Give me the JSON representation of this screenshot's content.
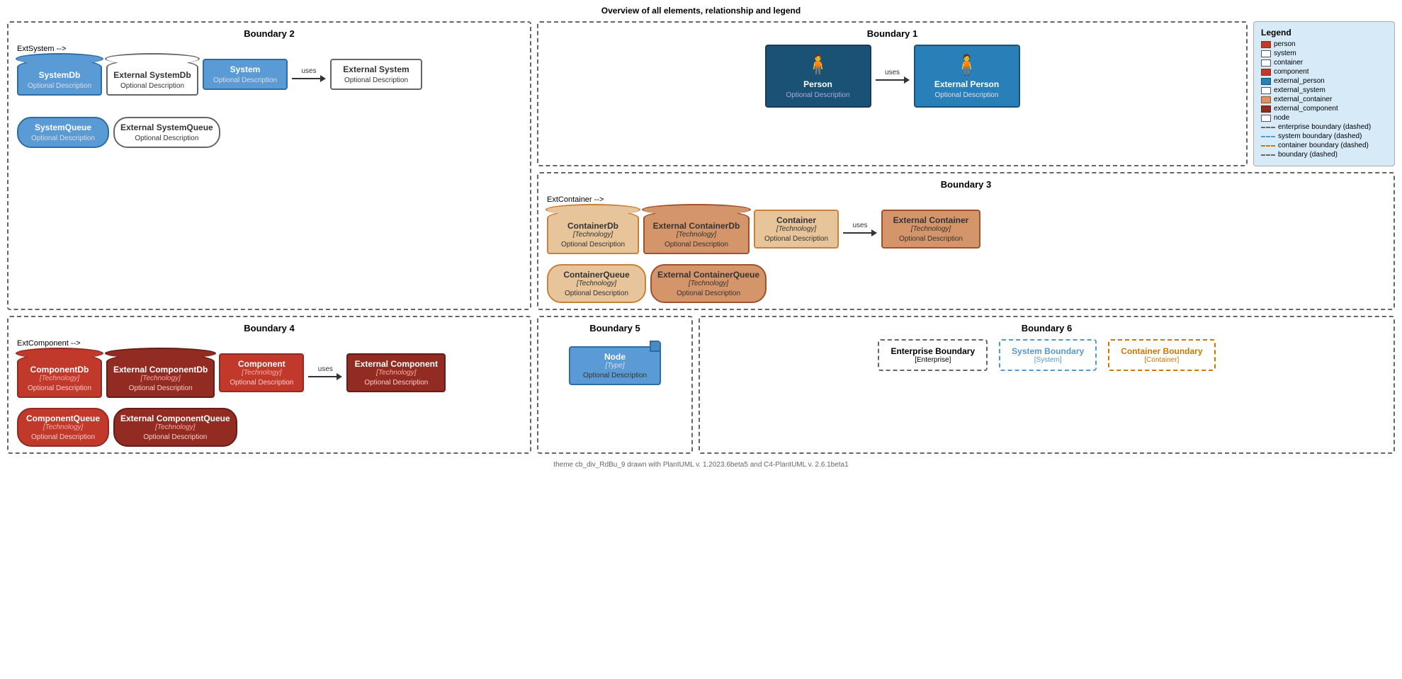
{
  "page": {
    "title": "Overview of all elements, relationship and legend",
    "footer": "theme cb_div_RdBu_9 drawn with PlantUML v. 1.2023.6beta5 and C4-PlantUML v. 2.6.1beta1"
  },
  "legend": {
    "title": "Legend",
    "items": [
      {
        "id": "person",
        "label": "person",
        "color": "#1a5276"
      },
      {
        "id": "system",
        "label": "system",
        "color": "#ffffff"
      },
      {
        "id": "container",
        "label": "container",
        "color": "#ffffff"
      },
      {
        "id": "component",
        "label": "component",
        "color": "#c0392b"
      },
      {
        "id": "external_person",
        "label": "external_person",
        "color": "#2980b9"
      },
      {
        "id": "external_system",
        "label": "external_system",
        "color": "#ffffff"
      },
      {
        "id": "external_container",
        "label": "external_container",
        "color": "#d4956a"
      },
      {
        "id": "external_component",
        "label": "external_component",
        "color": "#922b21"
      },
      {
        "id": "node",
        "label": "node",
        "color": "#ffffff"
      }
    ],
    "boundaries": [
      {
        "id": "enterprise_boundary",
        "label": "enterprise boundary (dashed)",
        "color": "#666666"
      },
      {
        "id": "system_boundary",
        "label": "system boundary (dashed)",
        "color": "#5599cc"
      },
      {
        "id": "container_boundary",
        "label": "container boundary (dashed)",
        "color": "#cc7700"
      },
      {
        "id": "boundary",
        "label": "boundary (dashed)",
        "color": "#666666"
      }
    ]
  },
  "boundary1": {
    "title": "Boundary 1",
    "person": {
      "title": "Person",
      "description": "Optional Description",
      "icon": "👤"
    },
    "ext_person": {
      "title": "External Person",
      "description": "Optional Description",
      "icon": "👤"
    },
    "arrow_label": "uses"
  },
  "boundary2": {
    "title": "Boundary 2",
    "system_db": {
      "title": "SystemDb",
      "description": "Optional Description"
    },
    "ext_system_db": {
      "title": "External SystemDb",
      "description": "Optional Description"
    },
    "system": {
      "title": "System",
      "description": "Optional Description"
    },
    "ext_system": {
      "title": "External System",
      "description": "Optional Description"
    },
    "arrow_label": "uses",
    "system_queue": {
      "title": "SystemQueue",
      "description": "Optional Description"
    },
    "ext_system_queue": {
      "title": "External SystemQueue",
      "description": "Optional Description"
    }
  },
  "boundary3": {
    "title": "Boundary 3",
    "container_db": {
      "title": "ContainerDb",
      "tech": "[Technology]",
      "description": "Optional Description"
    },
    "ext_container_db": {
      "title": "External ContainerDb",
      "tech": "[Technology]",
      "description": "Optional Description"
    },
    "container": {
      "title": "Container",
      "tech": "[Technology]",
      "description": "Optional Description"
    },
    "ext_container": {
      "title": "External Container",
      "tech": "[Technology]",
      "description": "Optional Description"
    },
    "arrow_label": "uses",
    "container_queue": {
      "title": "ContainerQueue",
      "tech": "[Technology]",
      "description": "Optional Description"
    },
    "ext_container_queue": {
      "title": "External ContainerQueue",
      "tech": "[Technology]",
      "description": "Optional Description"
    }
  },
  "boundary4": {
    "title": "Boundary 4",
    "component_db": {
      "title": "ComponentDb",
      "tech": "[Technology]",
      "description": "Optional Description"
    },
    "ext_component_db": {
      "title": "External ComponentDb",
      "tech": "[Technology]",
      "description": "Optional Description"
    },
    "component": {
      "title": "Component",
      "tech": "[Technology]",
      "description": "Optional Description"
    },
    "ext_component": {
      "title": "External Component",
      "tech": "[Technology]",
      "description": "Optional Description"
    },
    "arrow_label": "uses",
    "component_queue": {
      "title": "ComponentQueue",
      "tech": "[Technology]",
      "description": "Optional Description"
    },
    "ext_component_queue": {
      "title": "External ComponentQueue",
      "tech": "[Technology]",
      "description": "Optional Description"
    }
  },
  "boundary5": {
    "title": "Boundary 5",
    "node": {
      "title": "Node",
      "type": "[Type]",
      "description": "Optional Description"
    }
  },
  "boundary6": {
    "title": "Boundary 6",
    "enterprise": {
      "label": "Enterprise Boundary",
      "sublabel": "[Enterprise]"
    },
    "system": {
      "label": "System Boundary",
      "sublabel": "[System]"
    },
    "container": {
      "label": "Container Boundary",
      "sublabel": "[Container]"
    }
  }
}
